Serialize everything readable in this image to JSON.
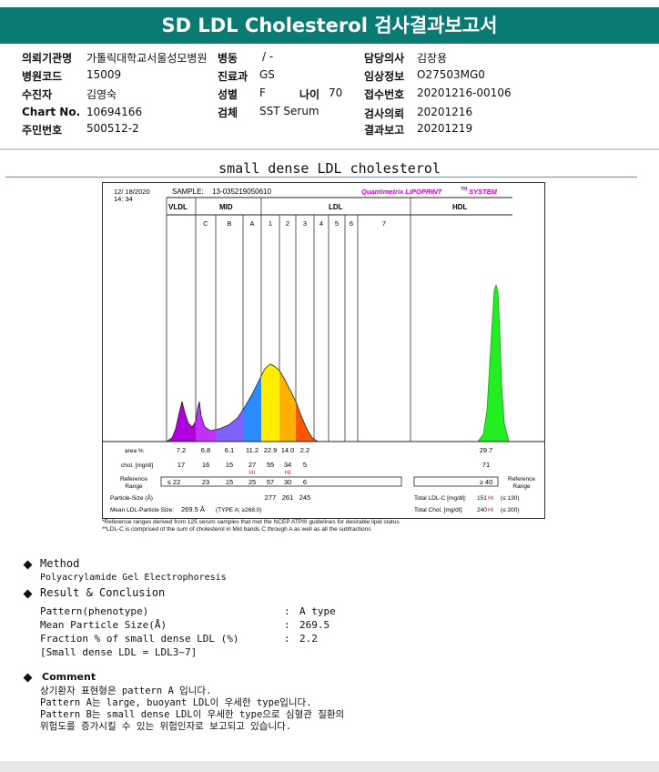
{
  "header": {
    "title": "SD LDL Cholesterol 검사결과보고서"
  },
  "patient": {
    "requesting_org_label": "의뢰기관명",
    "requesting_org_value": "가톨릭대학교서울성모병원",
    "ward_label": "병동",
    "ward_value": "/ -",
    "doctor_label": "담당의사",
    "doctor_value": "김장용",
    "hospital_code_label": "병원코드",
    "hospital_code_value": "15009",
    "dept_label": "진료과",
    "dept_value": "GS",
    "clinical_info_label": "임상정보",
    "clinical_info_value": "O27503MG0",
    "patient_name_label": "수진자",
    "patient_name_value": "김영숙",
    "sex_label": "성별",
    "sex_value": "F",
    "age_label": "나이",
    "age_value": "70",
    "receipt_no_label": "접수번호",
    "receipt_no_value": "20201216-00106",
    "chart_no_label": "Chart No.",
    "chart_no_value": "10694166",
    "specimen_label": "검체",
    "specimen_value": "SST Serum",
    "test_request_label": "검사의뢰",
    "test_request_value": "20201216",
    "id_no_label": "주민번호",
    "id_no_value": "500512-2",
    "report_label": "결과보고",
    "report_value": "20201219"
  },
  "section_title": "small dense LDL cholesterol",
  "lipoprint": {
    "date": "12/ 18/2020",
    "time": "14: 34",
    "sample_label": "SAMPLE:",
    "sample_value": "13-035219050610",
    "brand": "Quantimetrix LIPOPRINT",
    "brand_tm": "TM",
    "brand_suffix": "SYSTEM",
    "group_vldl": "VLDL",
    "group_mid": "MID",
    "group_ldl": "LDL",
    "group_hdl": "HDL",
    "bands": [
      "C",
      "B",
      "A",
      "1",
      "2",
      "3",
      "4",
      "5",
      "6",
      "7"
    ],
    "row_area_label": "area %",
    "row_chol_label": "chol. [mg/dl]",
    "row_ref_label_1": "Reference",
    "row_ref_label_2": "Range",
    "row_ref_right_1": "Reference",
    "row_ref_right_2": "Range",
    "area_values": [
      "7.2",
      "6.8",
      "6.1",
      "11.2",
      "22.9",
      "14.0",
      "2.2"
    ],
    "area_hdl": "29.7",
    "chol_values": [
      "17",
      "16",
      "15",
      "27",
      "55",
      "34",
      "5"
    ],
    "chol_hdl": "71",
    "hi_flag": "HI",
    "ref_values": [
      "≤ 22",
      "23",
      "15",
      "25",
      "57",
      "30",
      "6"
    ],
    "ref_hdl": "≥ 40",
    "particle_size_label": "Particle-Size (Å)",
    "particle_sizes": [
      "277",
      "261",
      "245"
    ],
    "mean_size_label": "Mean LDL-Particle Size:",
    "mean_size_value": "269.5 Å",
    "mean_size_type": "(TYPE A; ≥268.0)",
    "total_ldl_label": "Total LDL-C [mg/dl]:",
    "total_ldl_value": "151",
    "total_ldl_ref": "(≤ 130)",
    "total_chol_label": "Total Chol. [mg/dl]:",
    "total_chol_value": "240",
    "total_chol_ref": "(≤ 200)",
    "footnote_1": "*Reference ranges derived from 125 serum samples that met the NCEP ATPIII guidelines for desirable lipid status",
    "footnote_2": "**LDL-C is comprised of the sum of cholesterol in Mid bands C through A as well as all the subfractions",
    "colors": {
      "vldl": "#b000e0",
      "mid_c": "#c030ff",
      "mid_b": "#8060ff",
      "mid_a": "#2a8cff",
      "ldl1": "#ffee00",
      "ldl2": "#ffb000",
      "ldl3": "#ff5500",
      "hdl": "#22ee22",
      "brand": "#d400d4",
      "hi": "#e02020"
    }
  },
  "method": {
    "heading": "Method",
    "text": "Polyacrylamide Gel Electrophoresis"
  },
  "result": {
    "heading": "Result & Conclusion",
    "rows": [
      {
        "label": "Pattern(phenotype)",
        "sep": ":",
        "value": "A type"
      },
      {
        "label": "Mean Particle Size(Å)",
        "sep": ":",
        "value": "269.5"
      },
      {
        "label": "Fraction % of small dense LDL (%)",
        "sep": ":",
        "value": "2.2"
      }
    ],
    "note": "[Small dense LDL = LDL3~7]"
  },
  "comment": {
    "heading": "Comment",
    "lines": [
      "상기환자 표현형은 pattern A 입니다.",
      "Pattern A는 large, buoyant LDL이 우세한 type입니다.",
      "Pattern B는 small dense LDL이 우세한 type으로 심혈관 질환의",
      "위험도를 증가시킬 수 있는 위험인자로 보고되고 있습니다."
    ]
  }
}
